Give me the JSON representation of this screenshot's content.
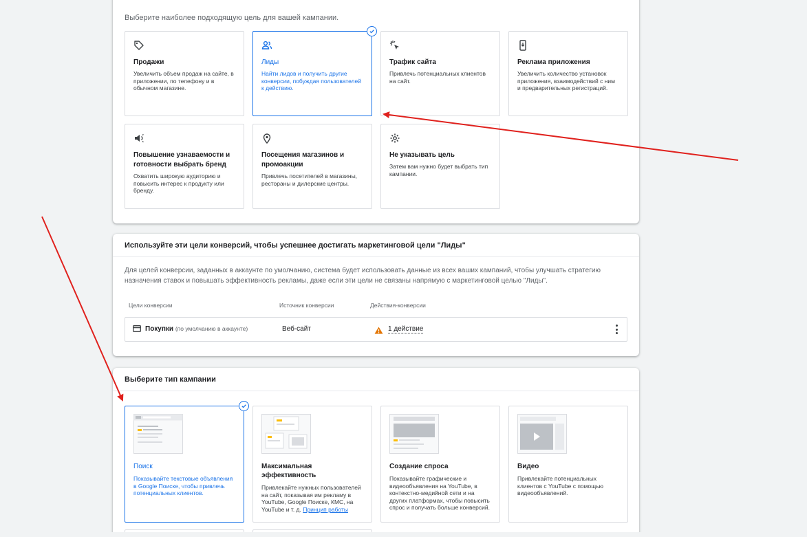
{
  "goals": {
    "subtitle": "Выберите наиболее подходящую цель для вашей кампании.",
    "items": [
      {
        "title": "Продажи",
        "desc": "Увеличить объем продаж на сайте, в приложении, по телефону и в обычном магазине.",
        "icon": "tag-icon"
      },
      {
        "title": "Лиды",
        "desc": "Найти лидов и получить другие конверсии, побуждая пользователей к действию.",
        "icon": "people-icon",
        "selected": true
      },
      {
        "title": "Трафик сайта",
        "desc": "Привлечь потенциальных клиентов на сайт.",
        "icon": "cursor-click-icon"
      },
      {
        "title": "Реклама приложения",
        "desc": "Увеличить количество установок приложения, взаимодействий с ним и предварительных регистраций.",
        "icon": "phone-icon"
      },
      {
        "title": "Повышение узнаваемости и готовности выбрать бренд",
        "desc": "Охватить широкую аудиторию и повысить интерес к продукту или бренду.",
        "icon": "megaphone-icon"
      },
      {
        "title": "Посещения магазинов и промоакции",
        "desc": "Привлечь посетителей в магазины, рестораны и дилерские центры.",
        "icon": "map-pin-icon"
      },
      {
        "title": "Не указывать цель",
        "desc": "Затем вам нужно будет выбрать тип кампании.",
        "icon": "gear-icon"
      }
    ]
  },
  "conversion": {
    "header": "Используйте эти цели конверсий, чтобы успешнее достигать маркетинговой цели \"Лиды\"",
    "paragraph": "Для целей конверсии, заданных в аккаунте по умолчанию, система будет использовать данные из всех ваших кампаний, чтобы улучшать стратегию назначения ставок и повышать эффективность рекламы, даже если эти цели не связаны напрямую с маркетинговой целью \"Лиды\".",
    "columns": [
      "Цели конверсии",
      "Источник конверсии",
      "Действия-конверсии"
    ],
    "row": {
      "goal": "Покупки",
      "goal_note": "(по умолчанию в аккаунте)",
      "source": "Веб-сайт",
      "actions": "1 действие"
    }
  },
  "campaign_type": {
    "header": "Выберите тип кампании",
    "items": [
      {
        "title": "Поиск",
        "desc": "Показывайте текстовые объявления в Google Поиске, чтобы привлечь потенциальных клиентов.",
        "selected": true
      },
      {
        "title": "Максимальная эффективность",
        "desc": "Привлекайте нужных пользователей на сайт, показывая им рекламу в YouTube, Google Поиске, КМС, на YouTube и т. д.",
        "link": "Принцип работы"
      },
      {
        "title": "Создание спроса",
        "desc": "Показывайте графические и видеообъявления на YouTube, в контекстно-медийной сети и на других платформах, чтобы повысить спрос и получать больше конверсий."
      },
      {
        "title": "Видео",
        "desc": "Привлекайте потенциальных клиентов с YouTube с помощью видеообъявлений."
      }
    ]
  },
  "colors": {
    "accent": "#1a73e8",
    "arrow": "#e0211d",
    "warning": "#e37400"
  }
}
